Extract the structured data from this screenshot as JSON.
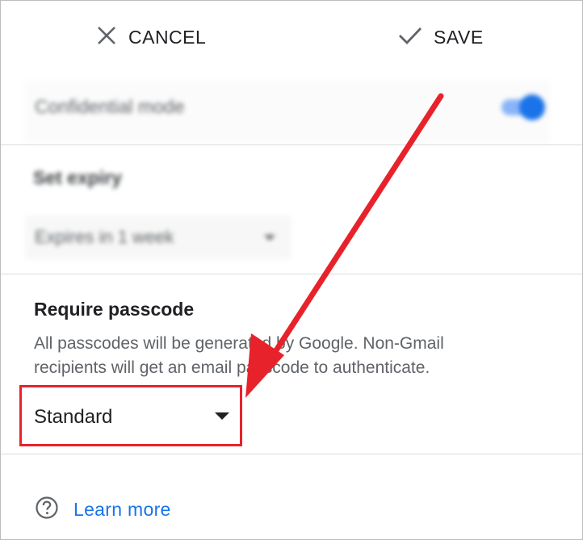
{
  "toolbar": {
    "cancel_label": "CANCEL",
    "save_label": "SAVE"
  },
  "confidential": {
    "label": "Confidential mode",
    "enabled": true
  },
  "expiry": {
    "title": "Set expiry",
    "selected": "Expires in 1 week"
  },
  "passcode": {
    "title": "Require passcode",
    "description": "All passcodes will be generated by Google. Non-Gmail recipients will get an email passcode to authenticate.",
    "selected": "Standard"
  },
  "help": {
    "learn_more_label": "Learn more"
  },
  "colors": {
    "accent": "#1a73e8",
    "annotation": "#e8222b"
  },
  "icons": {
    "cancel": "close-icon",
    "save": "check-icon",
    "help": "help-circle-icon"
  }
}
